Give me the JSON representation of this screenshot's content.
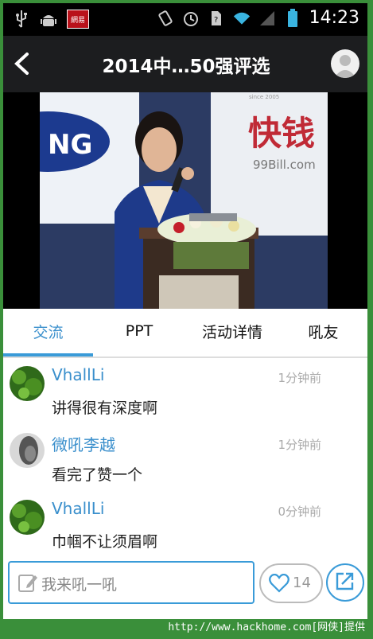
{
  "status_bar": {
    "left_icons": [
      "usb-icon",
      "android-debug-icon",
      "netease-app-icon"
    ],
    "netease_badge": "網易",
    "right_icons": [
      "vibrate-icon",
      "alarm-icon",
      "sim-icon",
      "wifi-icon",
      "signal-icon",
      "battery-icon"
    ],
    "time": "14:23"
  },
  "header": {
    "title": "2014中…50强评选",
    "back_icon": "back-arrow-icon",
    "avatar_icon": "user-avatar-icon"
  },
  "video": {
    "banner_left": "NG",
    "banner_right_logo": "快钱",
    "banner_right_url": "99Bill.com",
    "banner_right_since": "since 2005"
  },
  "tabs": [
    {
      "label": "交流",
      "active": true
    },
    {
      "label": "PPT",
      "active": false
    },
    {
      "label": "活动详情",
      "active": false
    },
    {
      "label": "吼友",
      "active": false
    }
  ],
  "comments": [
    {
      "name": "VhallLi",
      "time": "1分钟前",
      "text": "讲得很有深度啊"
    },
    {
      "name": "微吼李越",
      "time": "1分钟前",
      "text": "看完了赞一个"
    },
    {
      "name": "VhallLi",
      "time": "0分钟前",
      "text": "巾帼不让须眉啊"
    }
  ],
  "bottom_bar": {
    "input_placeholder": "我来吼一吼",
    "like_count": "14",
    "accent_color": "#3a9bd8"
  },
  "footer": {
    "text": "http://www.hackhome.com[网侠]提供"
  }
}
